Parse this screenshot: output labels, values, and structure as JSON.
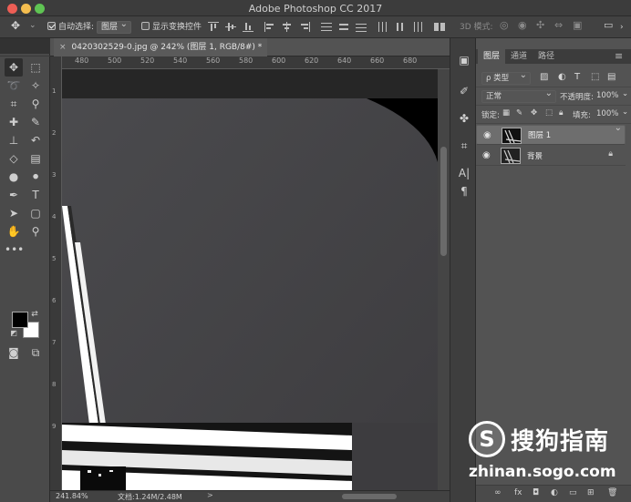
{
  "window": {
    "title": "Adobe Photoshop CC 2017"
  },
  "options_bar": {
    "auto_select_label": "自动选择:",
    "auto_select_target": "图层",
    "show_transform_label": "显示变换控件",
    "mode_3d_label": "3D 模式:"
  },
  "document": {
    "tab_title": "0420302529-0.jpg @ 242% (图层 1, RGB/8#) *",
    "close_glyph": "×"
  },
  "ruler": {
    "h_ticks": [
      "480",
      "500",
      "520",
      "540",
      "560",
      "580",
      "600",
      "620",
      "640",
      "660",
      "680"
    ],
    "v_ticks": [
      "1",
      "2",
      "3",
      "4",
      "5",
      "6",
      "7",
      "8",
      "9"
    ]
  },
  "status": {
    "zoom": "241.84%",
    "doc_size": "文档:1.24M/2.48M",
    "arrow": ">"
  },
  "panel": {
    "tabs": [
      "图层",
      "通道",
      "路径"
    ],
    "active_tab": 0,
    "kind_filter": "ρ 类型",
    "blend_mode": "正常",
    "opacity_label": "不透明度:",
    "opacity_value": "100%",
    "lock_label": "锁定:",
    "fill_label": "填充:",
    "fill_value": "100%",
    "layers": [
      {
        "name": "图层 1",
        "selected": true,
        "locked": false
      },
      {
        "name": "背景",
        "selected": false,
        "locked": true
      }
    ]
  },
  "watermark": {
    "logo_letter": "S",
    "brand": "搜狗指南",
    "url": "zhinan.sogo.com"
  },
  "colors": {
    "app_bg": "#323232",
    "panel_bg": "#535353",
    "canvas_bg": "#2f2f31",
    "foreground_swatch": "#000000",
    "background_swatch": "#ffffff"
  }
}
